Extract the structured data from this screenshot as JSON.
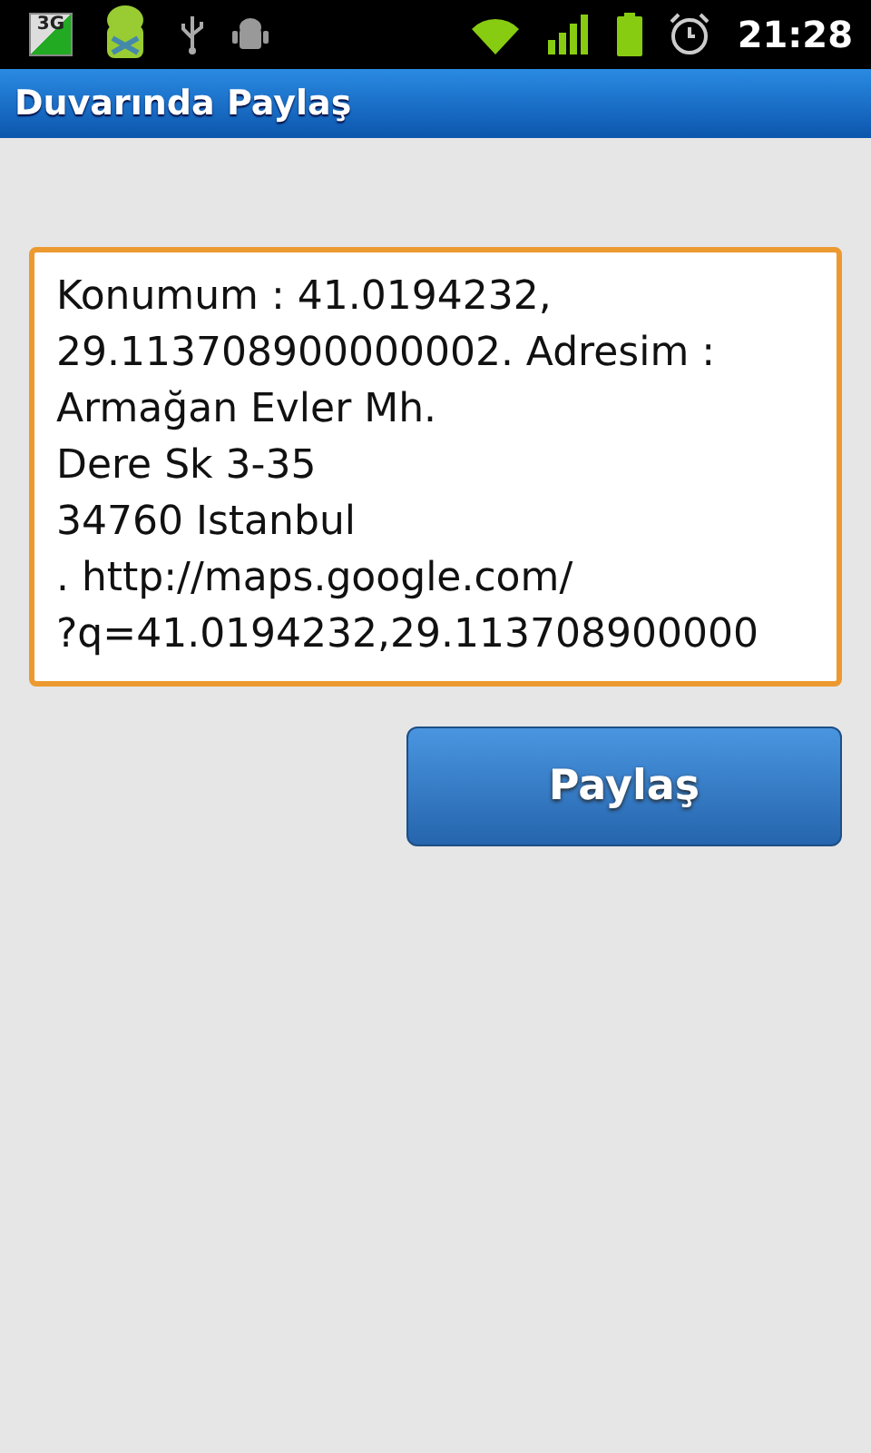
{
  "status_bar": {
    "network_label": "3G",
    "time": "21:28"
  },
  "title_bar": {
    "title": "Duvarında Paylaş"
  },
  "message_field": {
    "focused": true,
    "lines": [
      "Konumum : 41.0194232,",
      "29.113708900000002. Adresim :",
      "Armağan Evler Mh.",
      "Dere Sk 3-35",
      "34760 Istanbul",
      ". http://maps.google.com/",
      "?q=41.0194232,29.113708900000"
    ]
  },
  "share_button": {
    "label": "Paylaş"
  }
}
